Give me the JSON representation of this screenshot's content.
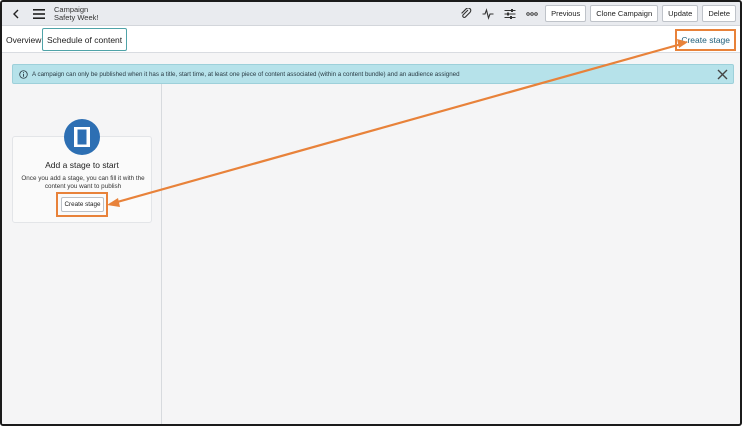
{
  "header": {
    "title_line1": "Campaign",
    "title_line2": "Safety Week!",
    "buttons": {
      "previous": "Previous",
      "clone": "Clone Campaign",
      "update": "Update",
      "delete": "Delete"
    }
  },
  "tabs": {
    "overview": "Overview",
    "schedule": "Schedule of content"
  },
  "top_action": {
    "create_stage": "Create stage"
  },
  "banner": {
    "message": "A campaign can only be published when it has a title, start time, at least one piece of content associated (within a content bundle) and an audience assigned"
  },
  "empty_state": {
    "title": "Add a stage to start",
    "description": "Once you add a stage, you can fill it with the content you want to publish",
    "button": "Create stage"
  },
  "colors": {
    "accent_orange": "#e8823a",
    "banner_bg": "#b6e2ea",
    "icon_blue": "#2d6fb3",
    "tab_outline": "#4fa3a8"
  }
}
